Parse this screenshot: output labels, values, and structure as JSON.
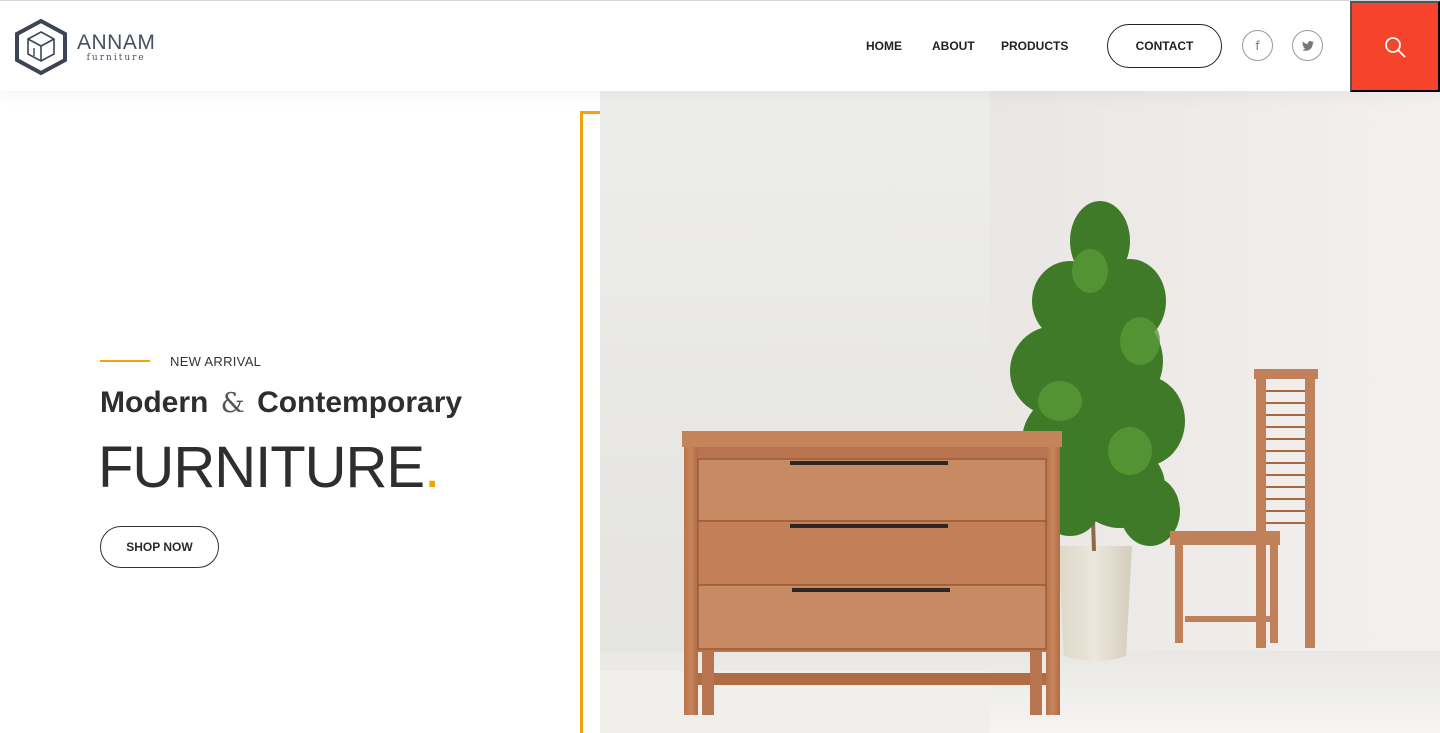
{
  "header": {
    "brand_name": "ANNAM",
    "brand_sub": "furniture",
    "nav": [
      {
        "label": "HOME"
      },
      {
        "label": "ABOUT"
      },
      {
        "label": "PRODUCTS"
      }
    ],
    "contact_label": "CONTACT",
    "social": [
      {
        "icon": "facebook-icon",
        "glyph": "f"
      },
      {
        "icon": "twitter-icon",
        "glyph": ""
      }
    ],
    "search_icon": "search-icon",
    "accent_color": "#f6432b"
  },
  "hero": {
    "eyebrow": "NEW ARRIVAL",
    "headline_part1": "Modern",
    "headline_amp": "&",
    "headline_part2": "Contemporary",
    "title": "FURNITURE",
    "title_dot": ".",
    "cta_label": "SHOP NOW",
    "accent_color": "#f4a20b",
    "image": "wooden-dresser-plant-chair"
  }
}
